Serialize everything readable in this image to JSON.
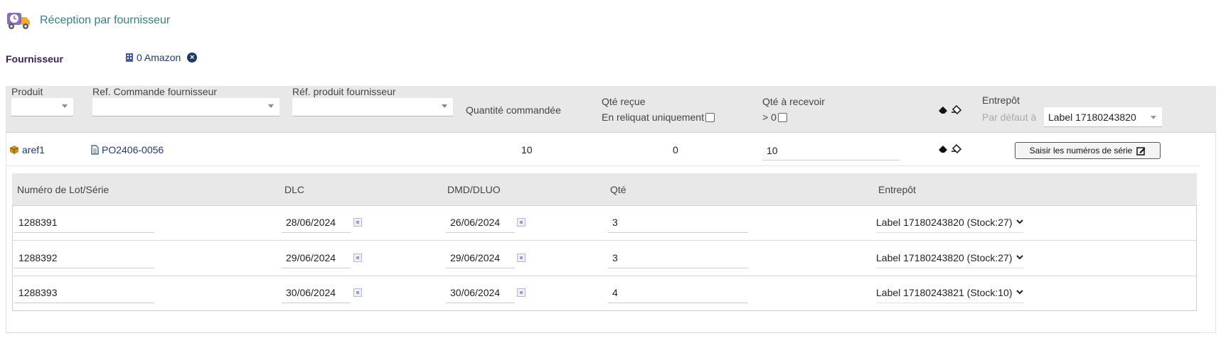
{
  "header": {
    "title": "Réception par fournisseur",
    "icon": "truck-clock-icon"
  },
  "supplier": {
    "label": "Fournisseur",
    "value": "0 Amazon",
    "icon": "building-icon",
    "clear_icon": "close-circle-icon"
  },
  "columns": {
    "produit": "Produit",
    "ref_commande": "Ref. Commande fournisseur",
    "ref_produit": "Réf. produit fournisseur",
    "qte_commandee": "Quantité commandée",
    "qte_recue": "Qté reçue",
    "reliquat": "En reliquat uniquement",
    "qte_a_recevoir": "Qté à recevoir",
    "gt_zero": "> 0",
    "entrepot": "Entrepôt",
    "par_defaut": "Par défaut à",
    "entrepot_default": "Label 17180243820"
  },
  "product_row": {
    "product": "aref1",
    "order_ref": "PO2406-0056",
    "qty_ordered": "10",
    "qty_received": "0",
    "qty_to_receive": "10",
    "serial_button": "Saisir les numéros de série"
  },
  "sub_columns": {
    "lot": "Numéro de Lot/Série",
    "dlc": "DLC",
    "dmd": "DMD/DLUO",
    "qte": "Qté",
    "entrepot": "Entrepôt"
  },
  "lots": [
    {
      "lot": "1288391",
      "dlc": "28/06/2024",
      "dmd": "26/06/2024",
      "qty": "3",
      "warehouse": "Label 17180243820 (Stock:27)"
    },
    {
      "lot": "1288392",
      "dlc": "29/06/2024",
      "dmd": "29/06/2024",
      "qty": "3",
      "warehouse": "Label 17180243820 (Stock:27)"
    },
    {
      "lot": "1288393",
      "dlc": "30/06/2024",
      "dmd": "30/06/2024",
      "qty": "4",
      "warehouse": "Label 17180243821 (Stock:10)"
    }
  ],
  "colors": {
    "title": "#3b7d85",
    "supplier_label": "#3a1d55",
    "link": "#223a6d",
    "header_bg": "#e8e8e8"
  }
}
